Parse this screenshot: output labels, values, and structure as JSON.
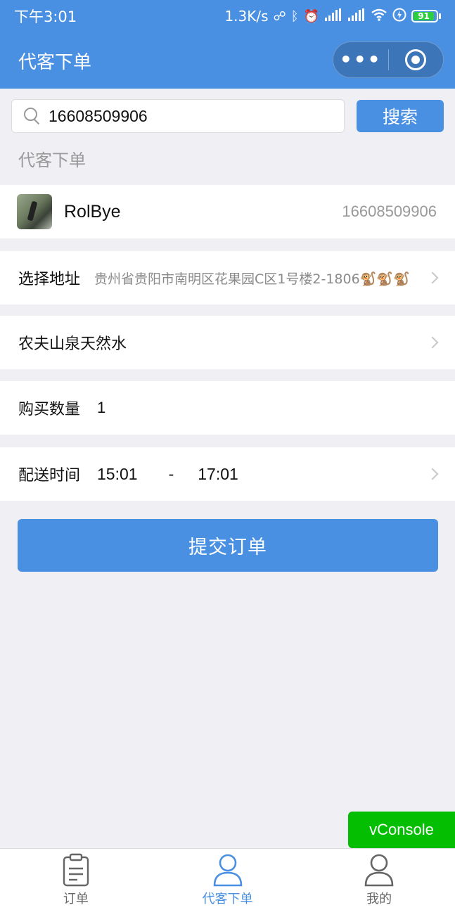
{
  "status_bar": {
    "time": "下午3:01",
    "network_speed": "1.3K/s",
    "icons": [
      "link-icon",
      "bluetooth-icon",
      "alarm-icon",
      "signal-icon",
      "signal-icon",
      "wifi-icon",
      "charging-icon"
    ],
    "battery": "91",
    "battery_level": 0.91
  },
  "nav": {
    "title": "代客下单",
    "more_label": "•••"
  },
  "search": {
    "value": "16608509906",
    "placeholder": "",
    "button_label": "搜索"
  },
  "section": {
    "label": "代客下单"
  },
  "user": {
    "name": "RolBye",
    "phone": "16608509906"
  },
  "order": {
    "address_label": "选择地址",
    "address_value": "贵州省贵阳市南明区花果园C区1号楼2-1806🐒🐒🐒",
    "product": "农夫山泉天然水",
    "quantity_label": "购买数量",
    "quantity_value": "1",
    "time_label": "配送时间",
    "time_start": "15:01",
    "time_dash": "-",
    "time_end": "17:01"
  },
  "submit": {
    "label": "提交订单"
  },
  "vconsole": {
    "label": "vConsole"
  },
  "tabs": [
    {
      "label": "订单",
      "icon": "clipboard-icon"
    },
    {
      "label": "代客下单",
      "icon": "user-icon"
    },
    {
      "label": "我的",
      "icon": "user-icon"
    }
  ],
  "colors": {
    "primary": "#4a90e2",
    "background": "#efeff4",
    "vconsole": "#04be02"
  }
}
